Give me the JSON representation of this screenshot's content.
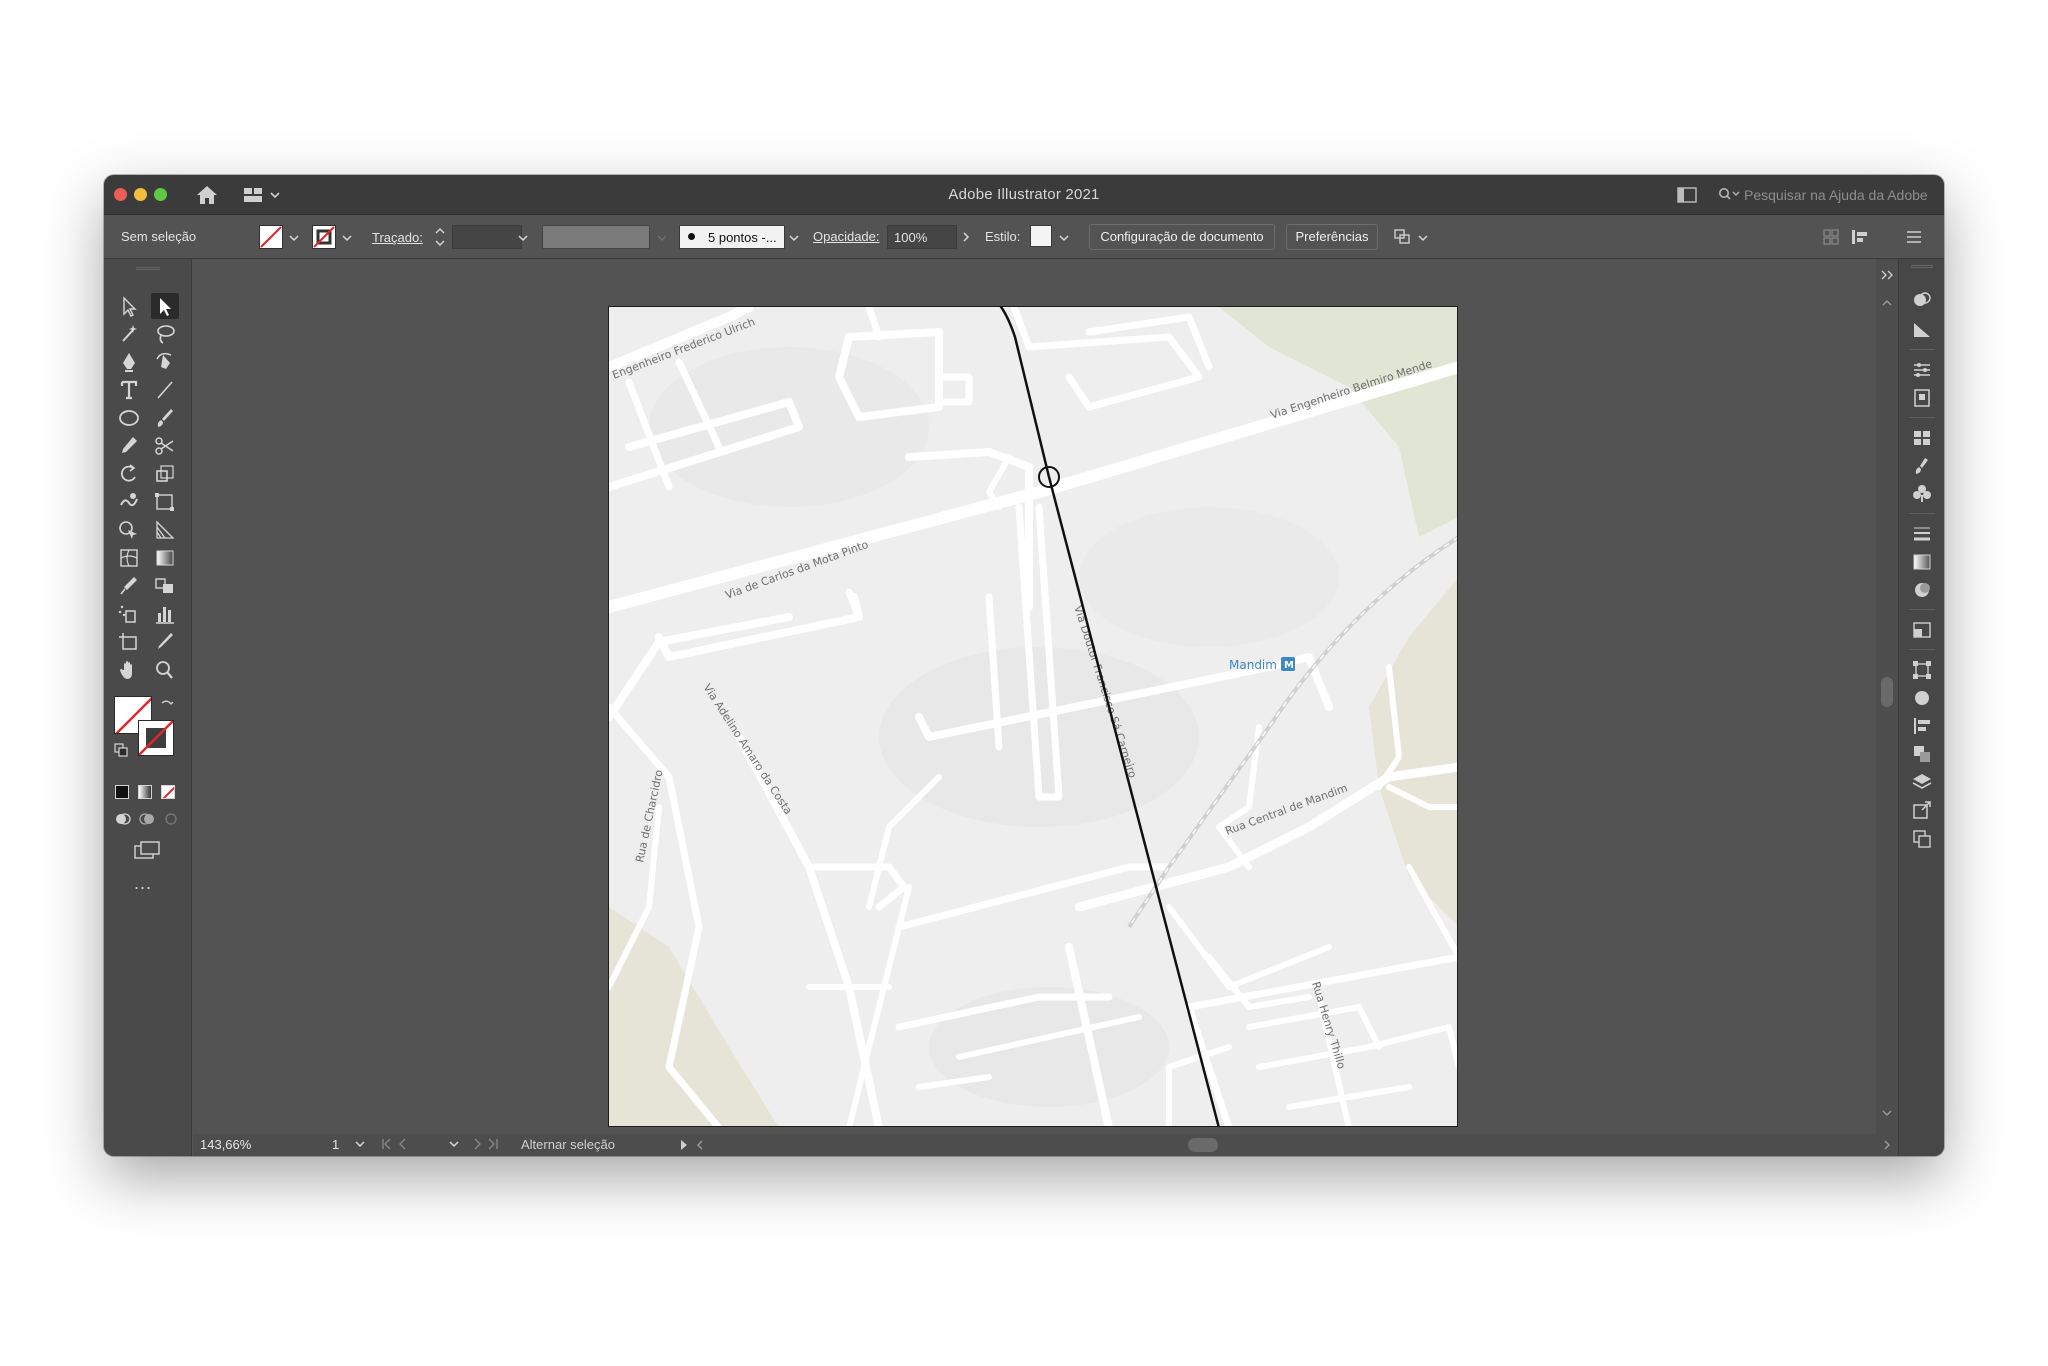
{
  "window": {
    "title": "Adobe Illustrator 2021",
    "help_search_placeholder": "Pesquisar na Ajuda da Adobe"
  },
  "control_bar": {
    "selection_status": "Sem seleção",
    "stroke_label": "Traçado:",
    "brush_label": "5 pontos -...",
    "opacity_label": "Opacidade:",
    "opacity_value": "100%",
    "style_label": "Estilo:",
    "document_setup_button": "Configuração de documento",
    "preferences_button": "Preferências"
  },
  "toolbar": {
    "tools": [
      "selection-tool",
      "direct-selection-tool",
      "magic-wand-tool",
      "lasso-tool",
      "pen-tool",
      "curvature-tool",
      "type-tool",
      "line-segment-tool",
      "ellipse-tool",
      "paintbrush-tool",
      "pencil-tool",
      "scissors-tool",
      "rotate-tool",
      "scale-tool",
      "warp-tool",
      "free-transform-tool",
      "shape-builder-tool",
      "perspective-grid-tool",
      "mesh-tool",
      "gradient-tool",
      "eyedropper-tool",
      "blend-tool",
      "symbol-sprayer-tool",
      "column-graph-tool",
      "artboard-tool",
      "slice-tool",
      "hand-tool",
      "zoom-tool"
    ],
    "active_tool": "direct-selection-tool",
    "more_tools_label": "..."
  },
  "map": {
    "street_labels": [
      "Engenheiro Frederico Ulrich",
      "Via Engenheiro Belmiro Mende",
      "Via de Carlos da Mota Pinto",
      "Via Doutor Francisco Sá Carneiro",
      "Via Adelino Amaro da Costa",
      "Rua de Charcidro",
      "Rua Central de Mandim",
      "Rua Henry Thillo"
    ],
    "metro_station": "Mandim",
    "metro_badge": "M",
    "colors": {
      "background": "#eeeeee",
      "roads": "#ffffff",
      "parks": "#e1e6d2",
      "labels": "#6f6f6f",
      "metro": "#3d87c4",
      "path": "#111111"
    }
  },
  "status_bar": {
    "zoom": "143,66%",
    "artboard_number": "1",
    "status_text": "Alternar seleção"
  },
  "dock": {
    "panels": [
      "color-themes",
      "cc-libraries",
      "properties",
      "links",
      "swatches",
      "brushes",
      "symbols",
      "stroke",
      "gradient",
      "transparency",
      "appearance",
      "transform",
      "align",
      "pathfinder",
      "layers",
      "export",
      "artboards"
    ]
  }
}
